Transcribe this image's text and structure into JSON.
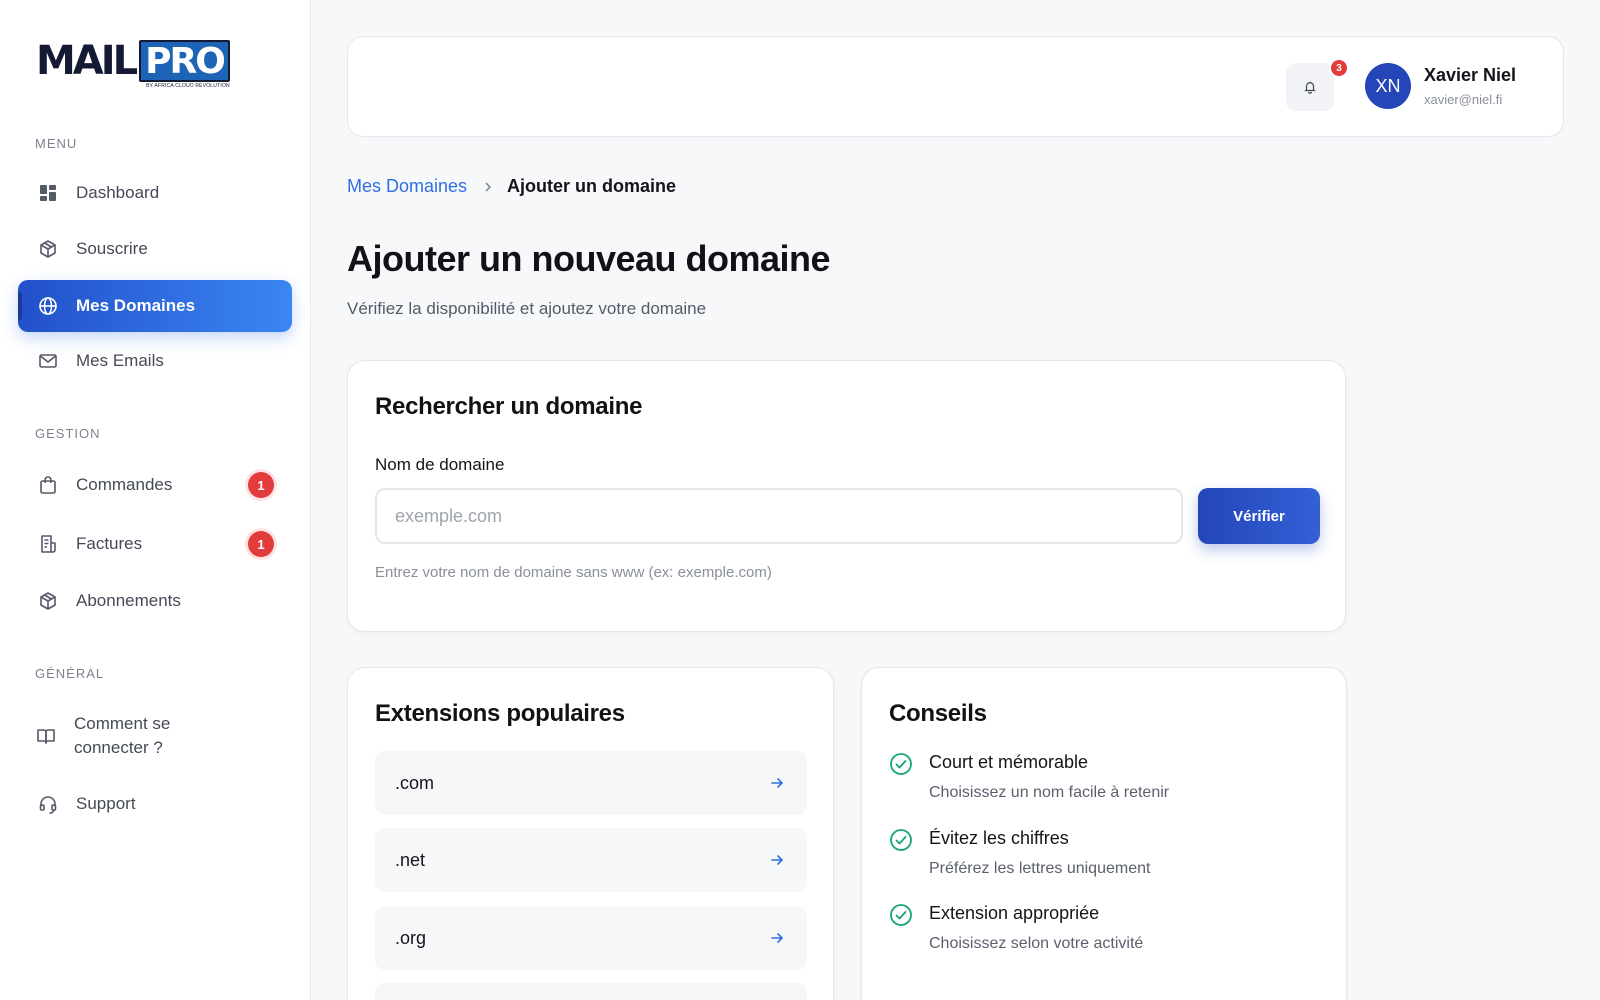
{
  "brand": {
    "name_left": "MAIL",
    "name_right": "PRO",
    "tagline": "BY AFRICA CLOUD REVOLUTION"
  },
  "sidebar": {
    "sections": [
      {
        "title": "MENU"
      },
      {
        "title": "GESTION"
      },
      {
        "title": "GÉNÉRAL"
      }
    ],
    "items": [
      {
        "label": "Dashboard",
        "icon": "dashboard-grid-icon"
      },
      {
        "label": "Souscrire",
        "icon": "package-cube-icon"
      },
      {
        "label": "Mes Domaines",
        "icon": "globe-icon",
        "active": true
      },
      {
        "label": "Mes Emails",
        "icon": "mail-envelope-icon"
      },
      {
        "label": "Commandes",
        "icon": "shopping-bag-icon",
        "badge": "1"
      },
      {
        "label": "Factures",
        "icon": "invoice-icon",
        "badge": "1"
      },
      {
        "label": "Abonnements",
        "icon": "package-cube-icon"
      },
      {
        "label": "Comment se connecter ?",
        "icon": "open-book-icon"
      },
      {
        "label": "Support",
        "icon": "headset-icon"
      }
    ]
  },
  "topbar": {
    "notification_count": "3",
    "user": {
      "initials": "XN",
      "name": "Xavier Niel",
      "email": "xavier@niel.fi"
    }
  },
  "breadcrumb": {
    "parent": "Mes Domaines",
    "current": "Ajouter un domaine"
  },
  "page": {
    "title": "Ajouter un nouveau domaine",
    "subtitle": "Vérifiez la disponibilité et ajoutez votre domaine"
  },
  "search_card": {
    "title": "Rechercher un domaine",
    "field_label": "Nom de domaine",
    "input_value": "",
    "input_placeholder": "exemple.com",
    "button_label": "Vérifier",
    "helper": "Entrez votre nom de domaine sans www (ex: exemple.com)"
  },
  "extensions_card": {
    "title": "Extensions populaires",
    "items": [
      ".com",
      ".net",
      ".org"
    ]
  },
  "tips_card": {
    "title": "Conseils",
    "items": [
      {
        "title": "Court et mémorable",
        "desc": "Choisissez un nom facile à retenir"
      },
      {
        "title": "Évitez les chiffres",
        "desc": "Préférez les lettres uniquement"
      },
      {
        "title": "Extension appropriée",
        "desc": "Choisissez selon votre activité"
      }
    ]
  },
  "colors": {
    "accent": "#2f6fe0",
    "accent_dark": "#2446b8",
    "badge": "#e23b3b",
    "success": "#17a673"
  }
}
